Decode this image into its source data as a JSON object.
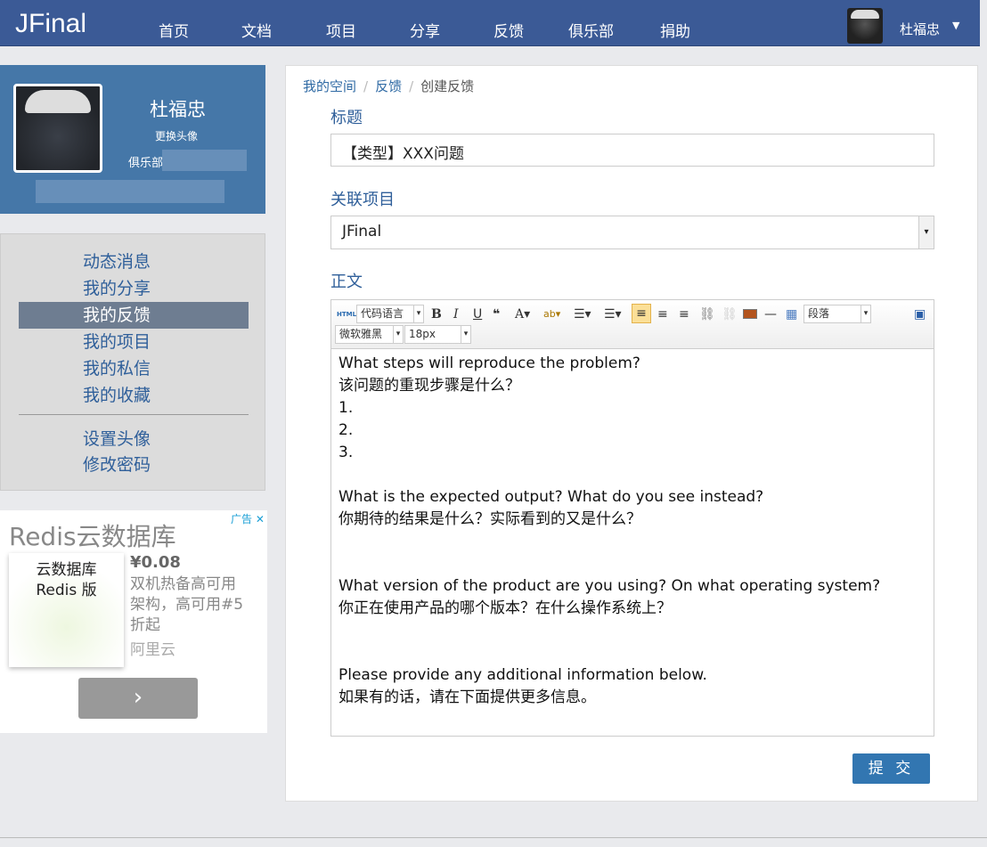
{
  "nav": {
    "logo": "JFinal",
    "items": [
      "首页",
      "文档",
      "项目",
      "分享",
      "反馈",
      "俱乐部",
      "捐助"
    ],
    "user": "杜福忠"
  },
  "profile": {
    "name": "杜福忠",
    "change_avatar": "更换头像",
    "club": "俱乐部"
  },
  "menu": {
    "items": [
      "动态消息",
      "我的分享",
      "我的反馈",
      "我的项目",
      "我的私信",
      "我的收藏"
    ],
    "active": "我的反馈",
    "settings": [
      "设置头像",
      "修改密码"
    ]
  },
  "ad": {
    "title": "Redis云数据库",
    "badge": "广告",
    "img_line1": "云数据库",
    "img_line2": "Redis 版",
    "price": "¥0.08",
    "desc": "双机热备高可用架构，高可用#5折起",
    "brand": "阿里云"
  },
  "breadcrumb": [
    "我的空间",
    "反馈",
    "创建反馈"
  ],
  "form": {
    "title_label": "标题",
    "title_value": "【类型】XXX问题",
    "project_label": "关联项目",
    "project_value": "JFinal",
    "body_label": "正文",
    "submit": "提 交"
  },
  "toolbar": {
    "html": "HTML",
    "code_lang": "代码语言",
    "paragraph": "段落",
    "font": "微软雅黑",
    "size": "18px"
  },
  "editor_body": "What steps will reproduce the problem?\n该问题的重现步骤是什么？\n1.\n2.\n3.\n\nWhat is the expected output? What do you see instead?\n你期待的结果是什么？实际看到的又是什么？\n\n\nWhat version of the product are you using? On what operating system?\n你正在使用产品的哪个版本？在什么操作系统上？\n\n\nPlease provide any additional information below.\n如果有的话，请在下面提供更多信息。"
}
